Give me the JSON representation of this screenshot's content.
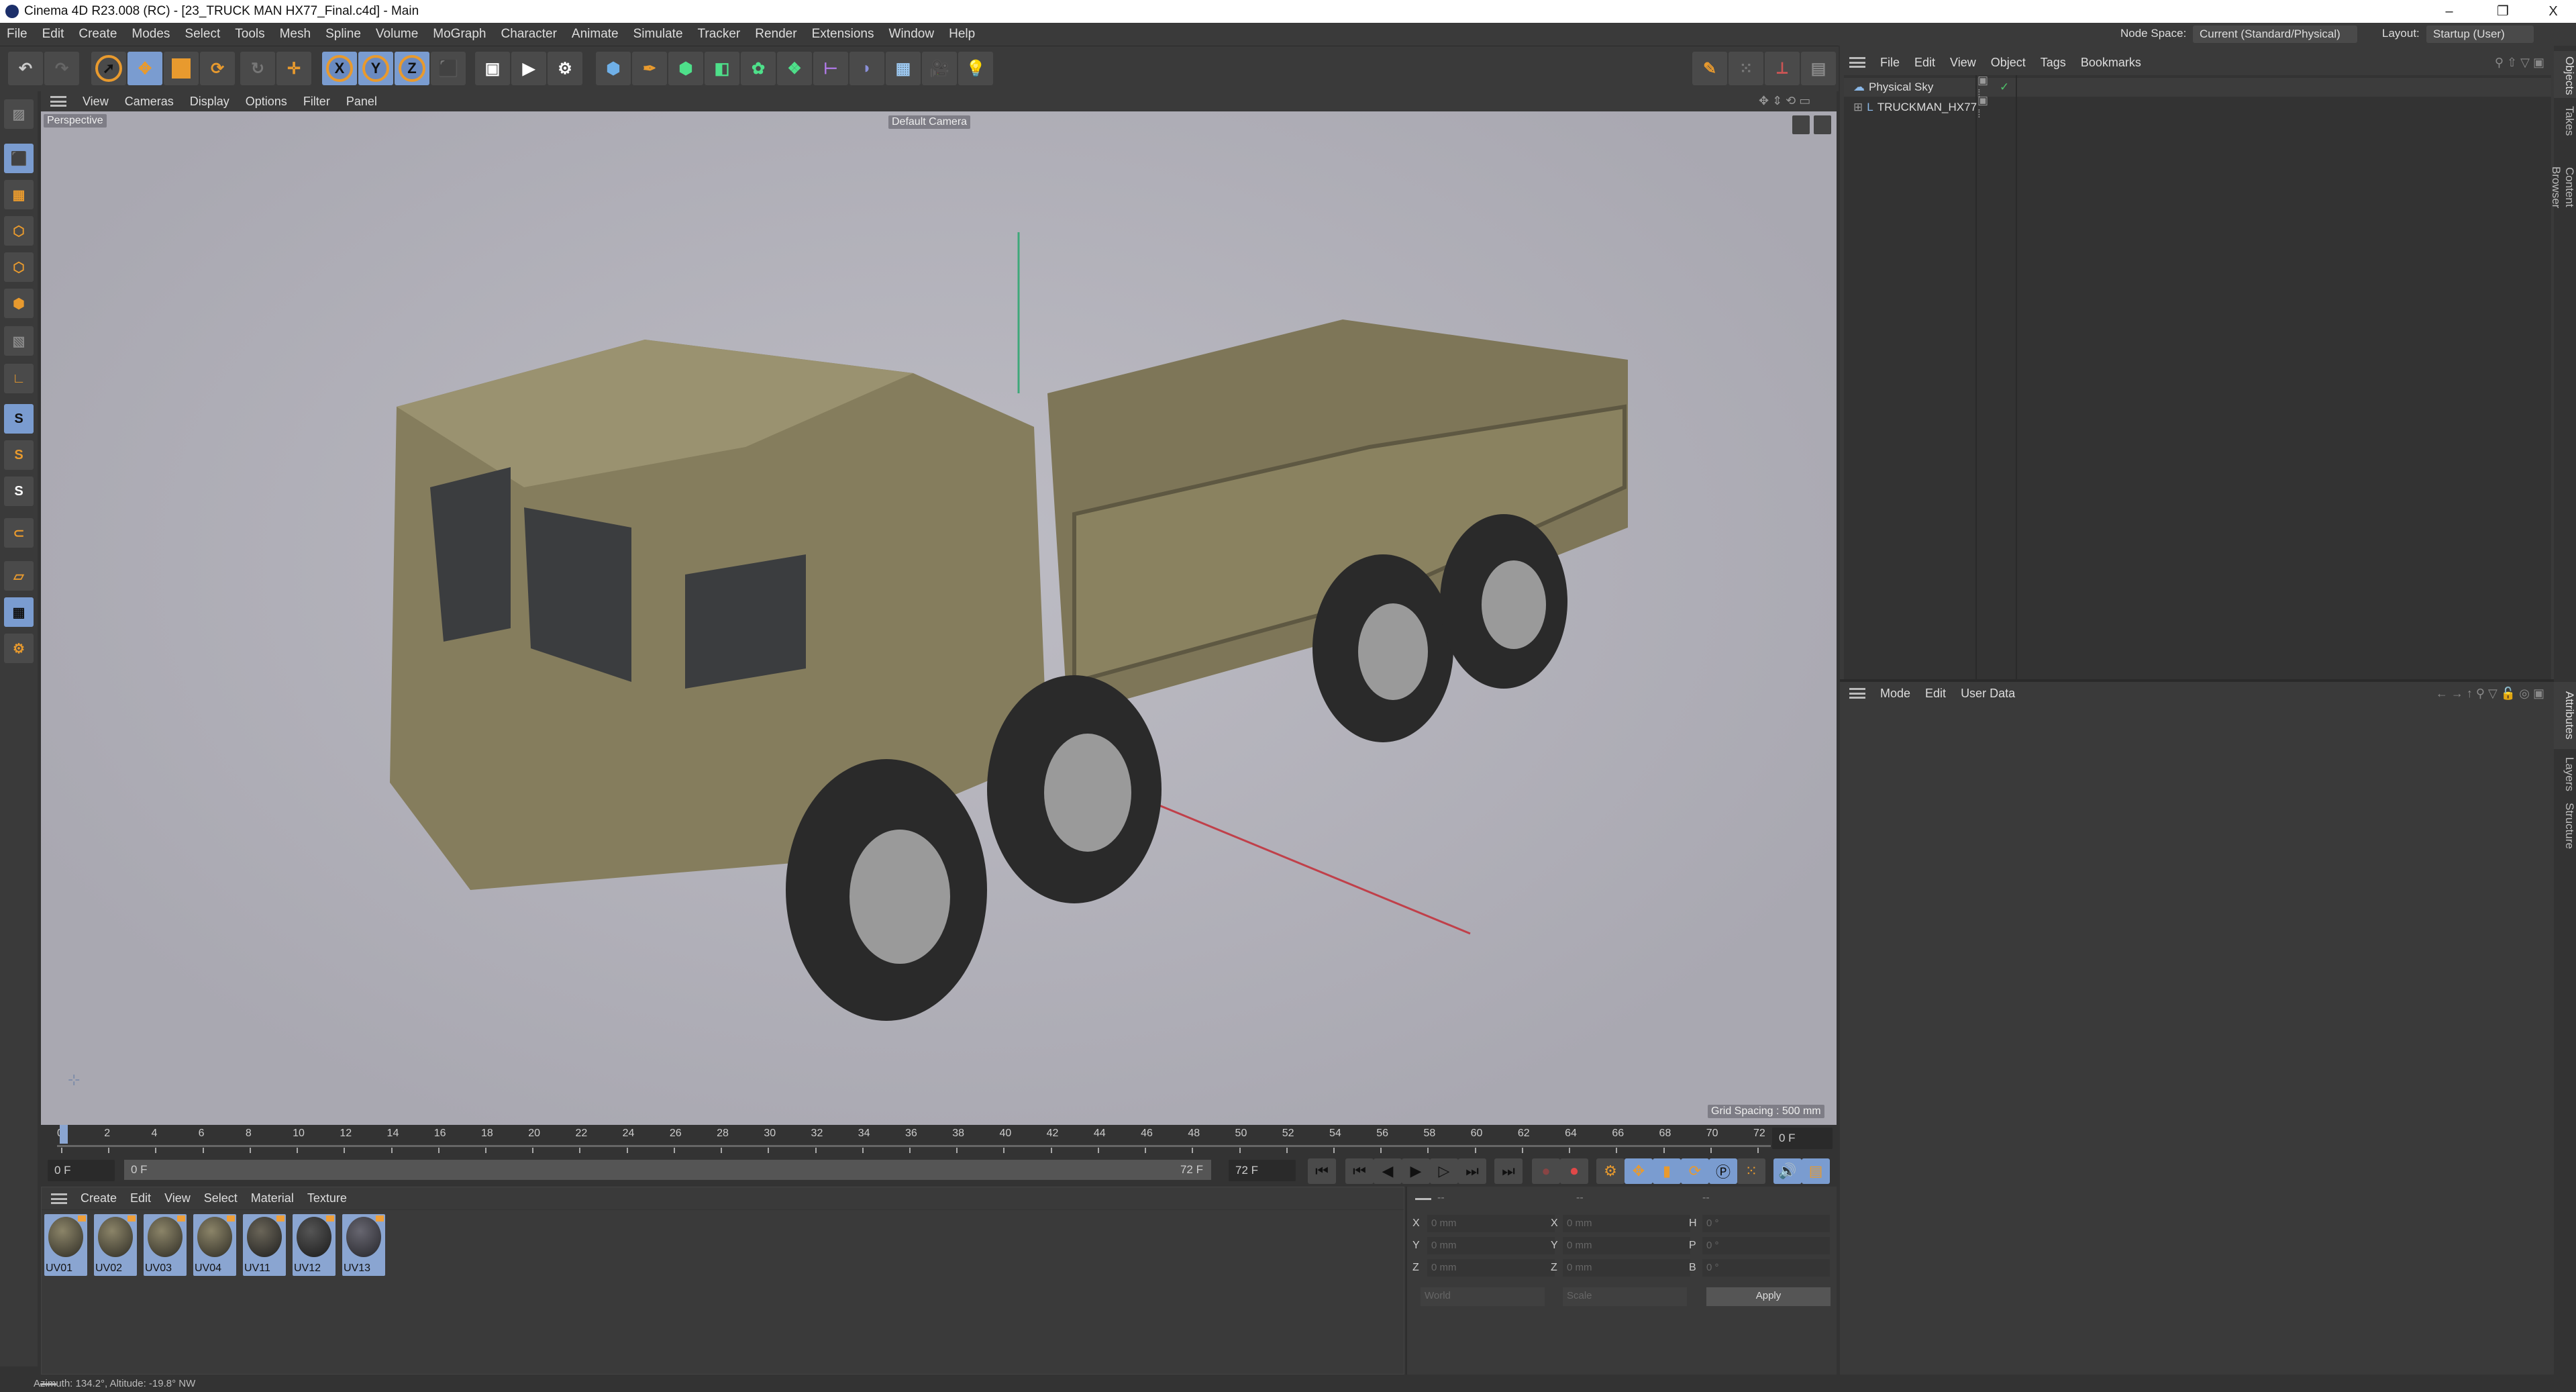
{
  "window": {
    "title": "Cinema 4D R23.008 (RC) - [23_TRUCK MAN HX77_Final.c4d] - Main",
    "minimize": "–",
    "maximize": "❐",
    "close": "X"
  },
  "menu": [
    "File",
    "Edit",
    "Create",
    "Modes",
    "Select",
    "Tools",
    "Mesh",
    "Spline",
    "Volume",
    "MoGraph",
    "Character",
    "Animate",
    "Simulate",
    "Tracker",
    "Render",
    "Extensions",
    "Window",
    "Help"
  ],
  "header": {
    "node_space_label": "Node Space:",
    "node_space_value": "Current (Standard/Physical)",
    "layout_label": "Layout:",
    "layout_value": "Startup (User)"
  },
  "toolbar": {
    "x": "X",
    "y": "Y",
    "z": "Z"
  },
  "left_tools": {
    "s1": "S",
    "s2": "S",
    "s3": "S"
  },
  "viewport": {
    "menu": [
      "View",
      "Cameras",
      "Display",
      "Options",
      "Filter",
      "Panel"
    ],
    "projection": "Perspective",
    "camera": "Default Camera",
    "grid_spacing": "Grid Spacing : 500 mm"
  },
  "timeline": {
    "ticks": [
      "0",
      "2",
      "4",
      "6",
      "8",
      "10",
      "12",
      "14",
      "16",
      "18",
      "20",
      "22",
      "24",
      "26",
      "28",
      "30",
      "32",
      "34",
      "36",
      "38",
      "40",
      "42",
      "44",
      "46",
      "48",
      "50",
      "52",
      "54",
      "56",
      "58",
      "60",
      "62",
      "64",
      "66",
      "68",
      "70",
      "72"
    ],
    "current_frame": "0 F",
    "start_frame": "0 F",
    "range_start": "0 F",
    "range_end": "72 F",
    "end_frame": "72 F"
  },
  "materials": {
    "menu": [
      "Create",
      "Edit",
      "View",
      "Select",
      "Material",
      "Texture"
    ],
    "items": [
      "UV01",
      "UV02",
      "UV03",
      "UV04",
      "UV11",
      "UV12",
      "UV13"
    ]
  },
  "coordinates": {
    "headers": [
      "--",
      "--",
      "--"
    ],
    "rows": [
      {
        "a": "X",
        "av": "0 mm",
        "b": "X",
        "bv": "0 mm",
        "c": "H",
        "cv": "0 °"
      },
      {
        "a": "Y",
        "av": "0 mm",
        "b": "Y",
        "bv": "0 mm",
        "c": "P",
        "cv": "0 °"
      },
      {
        "a": "Z",
        "av": "0 mm",
        "b": "Z",
        "bv": "0 mm",
        "c": "B",
        "cv": "0 °"
      }
    ],
    "space": "World",
    "mode": "Scale",
    "apply": "Apply"
  },
  "objects": {
    "menu": [
      "File",
      "Edit",
      "View",
      "Object",
      "Tags",
      "Bookmarks"
    ],
    "items": [
      "Physical Sky",
      "TRUCKMAN_HX77"
    ]
  },
  "attributes": {
    "menu": [
      "Mode",
      "Edit",
      "User Data"
    ]
  },
  "side_tabs_top": [
    "Objects",
    "Takes",
    "Content Browser"
  ],
  "side_tabs_bottom": [
    "Attributes",
    "Layers",
    "Structure"
  ],
  "status": "Azimuth: 134.2°, Altitude: -19.8°  NW"
}
